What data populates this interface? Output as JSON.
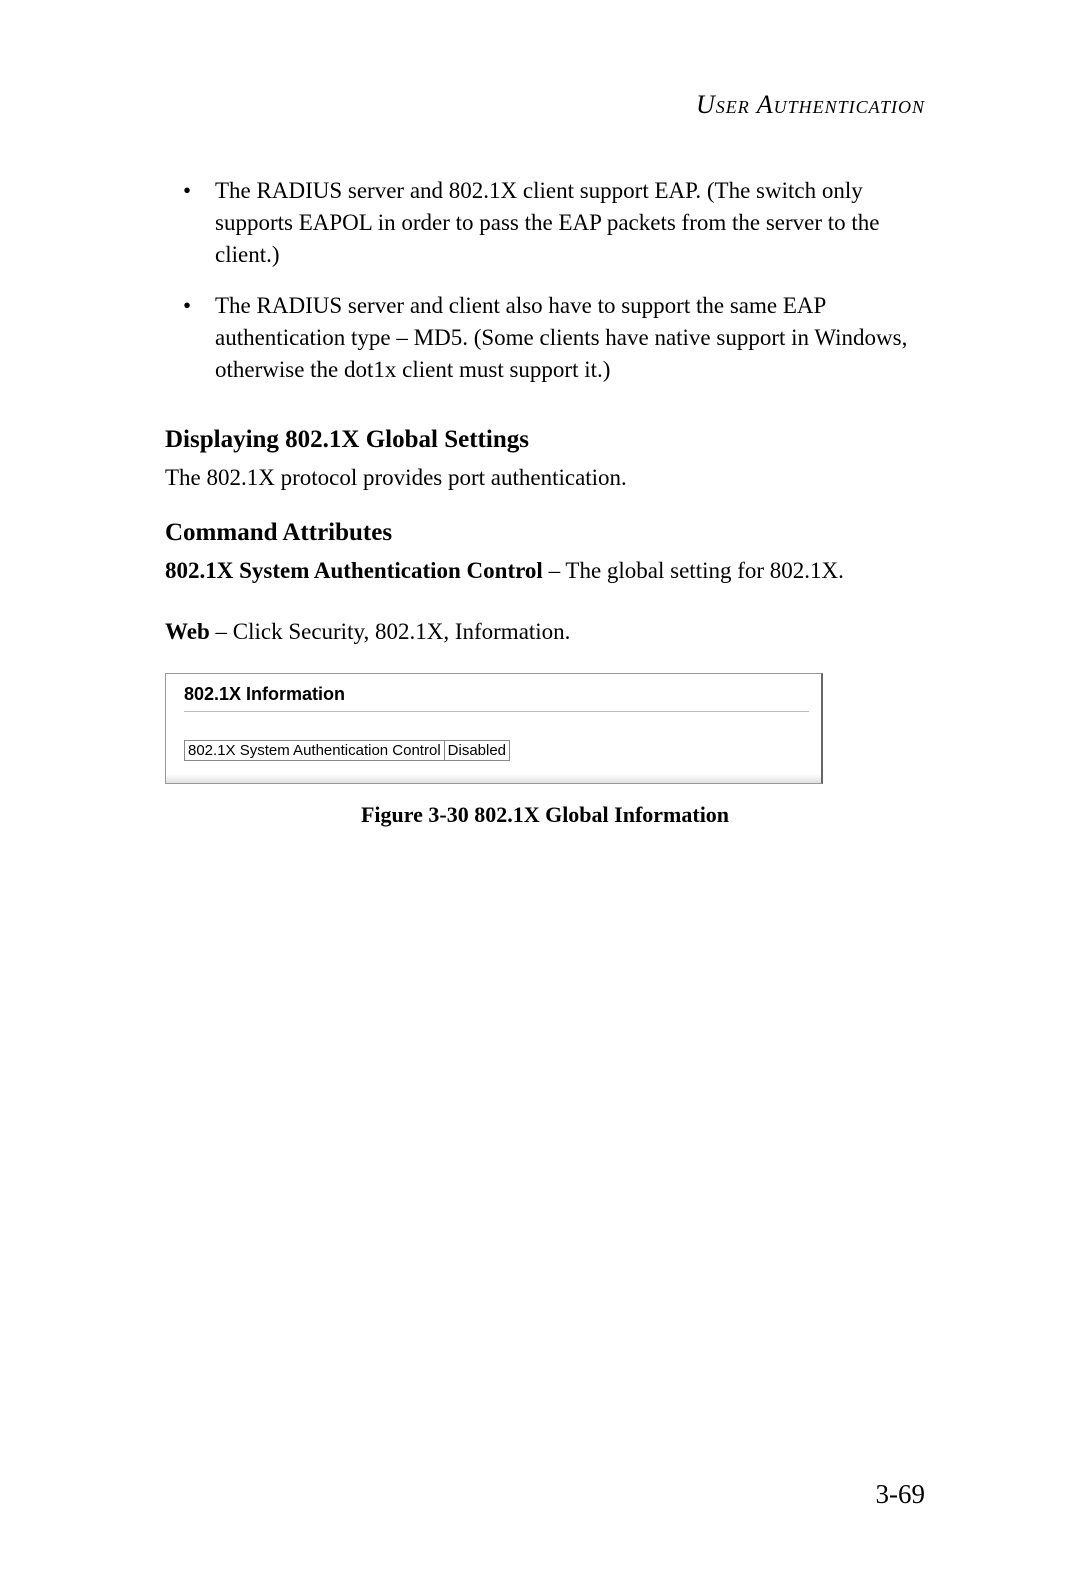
{
  "header": "User Authentication",
  "bullets": [
    "The RADIUS server and 802.1X client support EAP. (The switch only supports EAPOL in order to pass the EAP packets from the server to the client.)",
    "The RADIUS server and client also have to support the same EAP authentication type – MD5. (Some clients have native support in Windows, otherwise the dot1x client must support it.)"
  ],
  "section1": {
    "heading": "Displaying 802.1X Global Settings",
    "text": "The 802.1X protocol provides port authentication."
  },
  "section2": {
    "heading": "Command Attributes",
    "attr_bold": "802.1X System Authentication Control",
    "attr_rest": " – The global setting for 802.1X."
  },
  "web": {
    "bold": "Web",
    "rest": " – Click Security, 802.1X, Information."
  },
  "panel": {
    "title": "802.1X Information",
    "row_label": "802.1X System Authentication Control",
    "row_value": "Disabled"
  },
  "figure_caption": "Figure 3-30  802.1X Global Information",
  "page_number": "3-69"
}
